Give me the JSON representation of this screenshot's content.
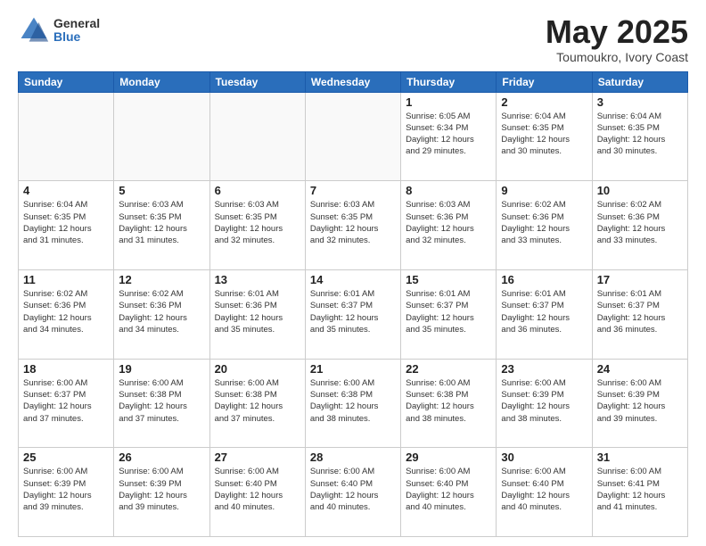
{
  "header": {
    "logo_general": "General",
    "logo_blue": "Blue",
    "month_title": "May 2025",
    "location": "Toumoukro, Ivory Coast"
  },
  "days_of_week": [
    "Sunday",
    "Monday",
    "Tuesday",
    "Wednesday",
    "Thursday",
    "Friday",
    "Saturday"
  ],
  "weeks": [
    [
      {
        "day": "",
        "info": ""
      },
      {
        "day": "",
        "info": ""
      },
      {
        "day": "",
        "info": ""
      },
      {
        "day": "",
        "info": ""
      },
      {
        "day": "1",
        "info": "Sunrise: 6:05 AM\nSunset: 6:34 PM\nDaylight: 12 hours\nand 29 minutes."
      },
      {
        "day": "2",
        "info": "Sunrise: 6:04 AM\nSunset: 6:35 PM\nDaylight: 12 hours\nand 30 minutes."
      },
      {
        "day": "3",
        "info": "Sunrise: 6:04 AM\nSunset: 6:35 PM\nDaylight: 12 hours\nand 30 minutes."
      }
    ],
    [
      {
        "day": "4",
        "info": "Sunrise: 6:04 AM\nSunset: 6:35 PM\nDaylight: 12 hours\nand 31 minutes."
      },
      {
        "day": "5",
        "info": "Sunrise: 6:03 AM\nSunset: 6:35 PM\nDaylight: 12 hours\nand 31 minutes."
      },
      {
        "day": "6",
        "info": "Sunrise: 6:03 AM\nSunset: 6:35 PM\nDaylight: 12 hours\nand 32 minutes."
      },
      {
        "day": "7",
        "info": "Sunrise: 6:03 AM\nSunset: 6:35 PM\nDaylight: 12 hours\nand 32 minutes."
      },
      {
        "day": "8",
        "info": "Sunrise: 6:03 AM\nSunset: 6:36 PM\nDaylight: 12 hours\nand 32 minutes."
      },
      {
        "day": "9",
        "info": "Sunrise: 6:02 AM\nSunset: 6:36 PM\nDaylight: 12 hours\nand 33 minutes."
      },
      {
        "day": "10",
        "info": "Sunrise: 6:02 AM\nSunset: 6:36 PM\nDaylight: 12 hours\nand 33 minutes."
      }
    ],
    [
      {
        "day": "11",
        "info": "Sunrise: 6:02 AM\nSunset: 6:36 PM\nDaylight: 12 hours\nand 34 minutes."
      },
      {
        "day": "12",
        "info": "Sunrise: 6:02 AM\nSunset: 6:36 PM\nDaylight: 12 hours\nand 34 minutes."
      },
      {
        "day": "13",
        "info": "Sunrise: 6:01 AM\nSunset: 6:36 PM\nDaylight: 12 hours\nand 35 minutes."
      },
      {
        "day": "14",
        "info": "Sunrise: 6:01 AM\nSunset: 6:37 PM\nDaylight: 12 hours\nand 35 minutes."
      },
      {
        "day": "15",
        "info": "Sunrise: 6:01 AM\nSunset: 6:37 PM\nDaylight: 12 hours\nand 35 minutes."
      },
      {
        "day": "16",
        "info": "Sunrise: 6:01 AM\nSunset: 6:37 PM\nDaylight: 12 hours\nand 36 minutes."
      },
      {
        "day": "17",
        "info": "Sunrise: 6:01 AM\nSunset: 6:37 PM\nDaylight: 12 hours\nand 36 minutes."
      }
    ],
    [
      {
        "day": "18",
        "info": "Sunrise: 6:00 AM\nSunset: 6:37 PM\nDaylight: 12 hours\nand 37 minutes."
      },
      {
        "day": "19",
        "info": "Sunrise: 6:00 AM\nSunset: 6:38 PM\nDaylight: 12 hours\nand 37 minutes."
      },
      {
        "day": "20",
        "info": "Sunrise: 6:00 AM\nSunset: 6:38 PM\nDaylight: 12 hours\nand 37 minutes."
      },
      {
        "day": "21",
        "info": "Sunrise: 6:00 AM\nSunset: 6:38 PM\nDaylight: 12 hours\nand 38 minutes."
      },
      {
        "day": "22",
        "info": "Sunrise: 6:00 AM\nSunset: 6:38 PM\nDaylight: 12 hours\nand 38 minutes."
      },
      {
        "day": "23",
        "info": "Sunrise: 6:00 AM\nSunset: 6:39 PM\nDaylight: 12 hours\nand 38 minutes."
      },
      {
        "day": "24",
        "info": "Sunrise: 6:00 AM\nSunset: 6:39 PM\nDaylight: 12 hours\nand 39 minutes."
      }
    ],
    [
      {
        "day": "25",
        "info": "Sunrise: 6:00 AM\nSunset: 6:39 PM\nDaylight: 12 hours\nand 39 minutes."
      },
      {
        "day": "26",
        "info": "Sunrise: 6:00 AM\nSunset: 6:39 PM\nDaylight: 12 hours\nand 39 minutes."
      },
      {
        "day": "27",
        "info": "Sunrise: 6:00 AM\nSunset: 6:40 PM\nDaylight: 12 hours\nand 40 minutes."
      },
      {
        "day": "28",
        "info": "Sunrise: 6:00 AM\nSunset: 6:40 PM\nDaylight: 12 hours\nand 40 minutes."
      },
      {
        "day": "29",
        "info": "Sunrise: 6:00 AM\nSunset: 6:40 PM\nDaylight: 12 hours\nand 40 minutes."
      },
      {
        "day": "30",
        "info": "Sunrise: 6:00 AM\nSunset: 6:40 PM\nDaylight: 12 hours\nand 40 minutes."
      },
      {
        "day": "31",
        "info": "Sunrise: 6:00 AM\nSunset: 6:41 PM\nDaylight: 12 hours\nand 41 minutes."
      }
    ]
  ]
}
